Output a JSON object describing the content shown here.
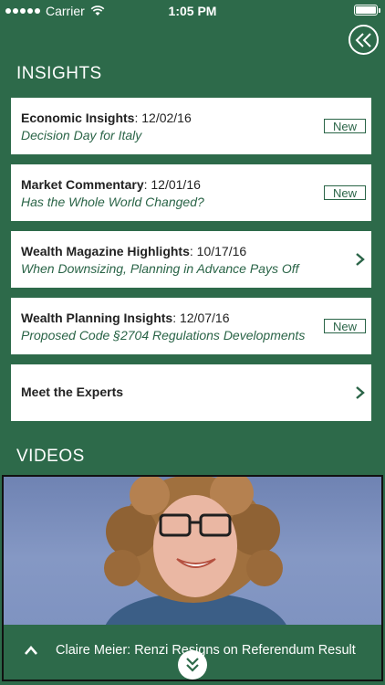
{
  "status_bar": {
    "carrier": "Carrier",
    "time": "1:05 PM"
  },
  "nav": {
    "back_icon": "double-chevron-left-icon"
  },
  "insights": {
    "heading": "INSIGHTS",
    "items": [
      {
        "category": "Economic Insights",
        "date": ": 12/02/16",
        "title": "Decision Day for Italy",
        "badge": "New"
      },
      {
        "category": "Market Commentary",
        "date": ": 12/01/16",
        "title": "Has the Whole World Changed?",
        "badge": "New"
      },
      {
        "category": "Wealth Magazine Highlights",
        "date": ": 10/17/16",
        "title": "When Downsizing, Planning in Advance Pays Off",
        "badge": null
      },
      {
        "category": "Wealth Planning Insights",
        "date": ": 12/07/16",
        "title": "Proposed Code §2704 Regulations Developments",
        "badge": "New"
      }
    ],
    "experts_label": "Meet the Experts"
  },
  "videos": {
    "heading": "VIDEOS",
    "current_caption": "Claire Meier: Renzi Resigns on Referendum Result"
  },
  "colors": {
    "brand_green": "#2d6a4a",
    "text_green": "#2a6447"
  }
}
